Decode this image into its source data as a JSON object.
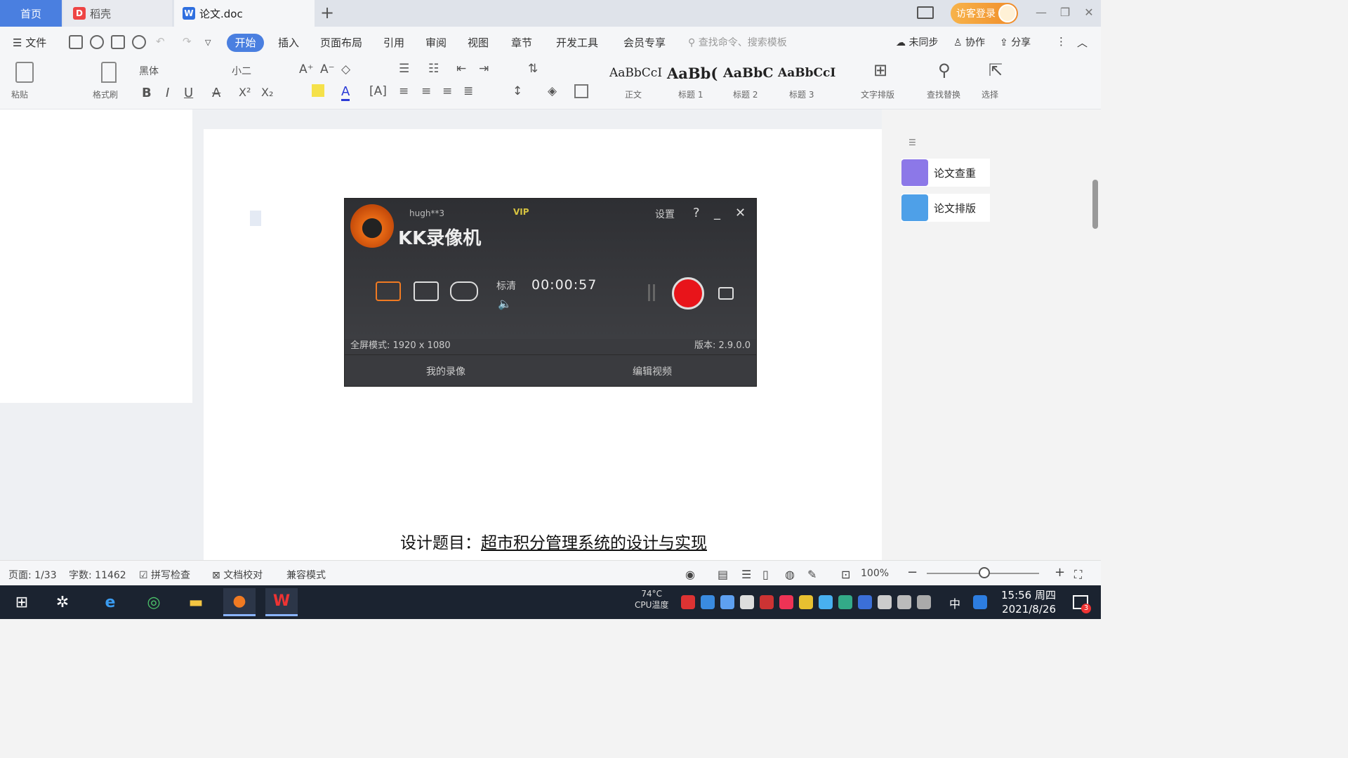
{
  "tabs": {
    "home": "首页",
    "daoke": "稻壳",
    "doc": "论文.doc",
    "new": "+"
  },
  "header": {
    "login": "访客登录"
  },
  "menu": {
    "file": "文件",
    "items": [
      "开始",
      "插入",
      "页面布局",
      "引用",
      "审阅",
      "视图",
      "章节",
      "开发工具",
      "会员专享"
    ],
    "search_placeholder": "查找命令、搜索模板",
    "sync": "未同步",
    "collab": "协作",
    "share": "分享"
  },
  "ribbon": {
    "paste": "粘贴",
    "format_painter": "格式刷",
    "font": "黑体",
    "font_size": "小二",
    "bold": "B",
    "italic": "I",
    "underline": "U",
    "styles": [
      {
        "sample": "AaBbCcI",
        "label": "正文"
      },
      {
        "sample": "AaBb(",
        "label": "标题 1"
      },
      {
        "sample": "AaBbC",
        "label": "标题 2"
      },
      {
        "sample": "AaBbCcI",
        "label": "标题 3"
      }
    ],
    "text_tools": "文字排版",
    "find_replace": "查找替换",
    "select": "选择"
  },
  "recorder": {
    "name": "KK录像机",
    "user": "hugh**3",
    "vip": "VIP",
    "settings": "设置",
    "help": "?",
    "minimize": "_",
    "close": "✕",
    "quality": "标清",
    "timer": "00:00:57",
    "mode_info": "全屏模式: 1920 x 1080",
    "version": "版本: 2.9.0.0",
    "my_recordings": "我的录像",
    "edit_video": "编辑视频"
  },
  "document": {
    "title_label": "设计题目：",
    "title_value": "超市积分管理系统的设计与实现"
  },
  "right_panel": {
    "items": [
      "论文查重",
      "论文排版"
    ]
  },
  "status": {
    "page": "页面: 1/33",
    "words": "字数: 11462",
    "spell": "拼写检查",
    "proof": "文档校对",
    "compat": "兼容模式",
    "zoom": "100%",
    "zoom_level": 0.5
  },
  "taskbar": {
    "cpu_temp": "74°C",
    "cpu_label": "CPU温度",
    "ime": "中",
    "time": "15:56 周四",
    "date": "2021/8/26",
    "notifications": "3"
  },
  "colors": {
    "accent": "#4a7fe0",
    "record": "#e8141a",
    "login": "#f08c2a"
  }
}
